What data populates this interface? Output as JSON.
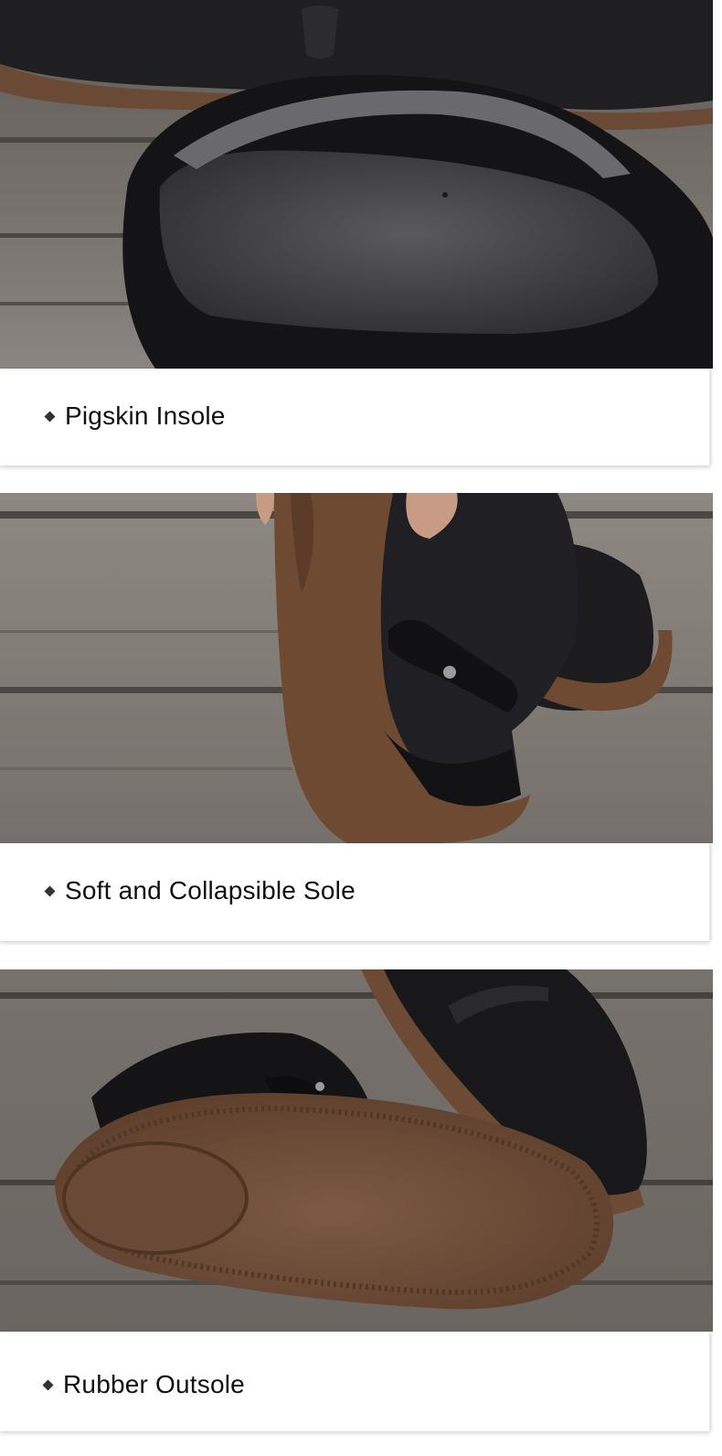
{
  "sections": [
    {
      "caption": "Pigskin Insole",
      "photo": "pigskin-insole-photo"
    },
    {
      "caption": "Soft and Collapsible Sole",
      "photo": "collapsible-sole-photo"
    },
    {
      "caption": "Rubber Outsole",
      "photo": "rubber-outsole-photo"
    }
  ],
  "bullet_icon": "diamond-icon",
  "colors": {
    "leather": "#1b1b1d",
    "sole": "#6e4a33",
    "wood": "#7d7873",
    "caption_bg": "#ffffff",
    "text": "#111111"
  }
}
